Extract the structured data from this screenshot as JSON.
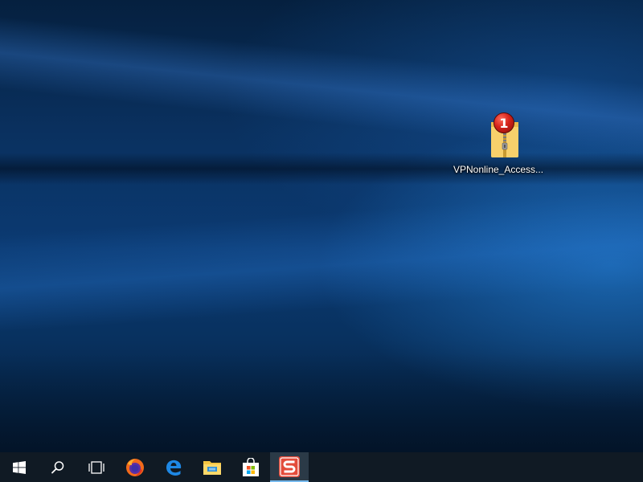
{
  "desktop": {
    "icons": [
      {
        "label": "VPNonline_Access...",
        "icon": "zip-folder-icon",
        "badge": "1"
      }
    ]
  },
  "taskbar": {
    "buttons": [
      {
        "icon": "windows-start-icon"
      },
      {
        "icon": "search-icon"
      },
      {
        "icon": "task-view-icon"
      },
      {
        "icon": "firefox-icon"
      },
      {
        "icon": "edge-icon"
      },
      {
        "icon": "file-explorer-icon"
      },
      {
        "icon": "store-icon"
      },
      {
        "icon": "sumatra-app-icon",
        "active": true
      }
    ]
  },
  "colors": {
    "taskbar_bg": "#101a24",
    "active_indicator": "#76b9ed",
    "badge_red": "#d4221a"
  }
}
